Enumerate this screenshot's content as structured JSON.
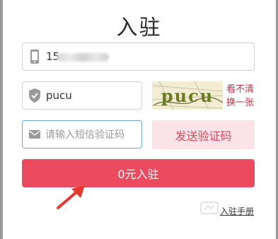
{
  "dialog": {
    "title": "入驻"
  },
  "phone_field": {
    "value": "15",
    "icon": "mobile-phone-icon"
  },
  "captcha_field": {
    "value": "pucu",
    "icon": "shield-icon"
  },
  "captcha_image": {
    "text": "pucu"
  },
  "captcha_refresh": {
    "line1": "看不清",
    "line2": "换一张"
  },
  "sms_field": {
    "placeholder": "请输入短信验证码",
    "icon": "envelope-icon"
  },
  "sms_button": {
    "label": "发送验证码"
  },
  "submit_button": {
    "label": "0元入驻"
  },
  "guide_link": {
    "label": "入驻手册"
  },
  "colors": {
    "accent": "#ec4a5e",
    "sms_button_bg": "#fbe4e7",
    "link_red": "#c2334a",
    "focus_border": "#6fa7d8"
  }
}
